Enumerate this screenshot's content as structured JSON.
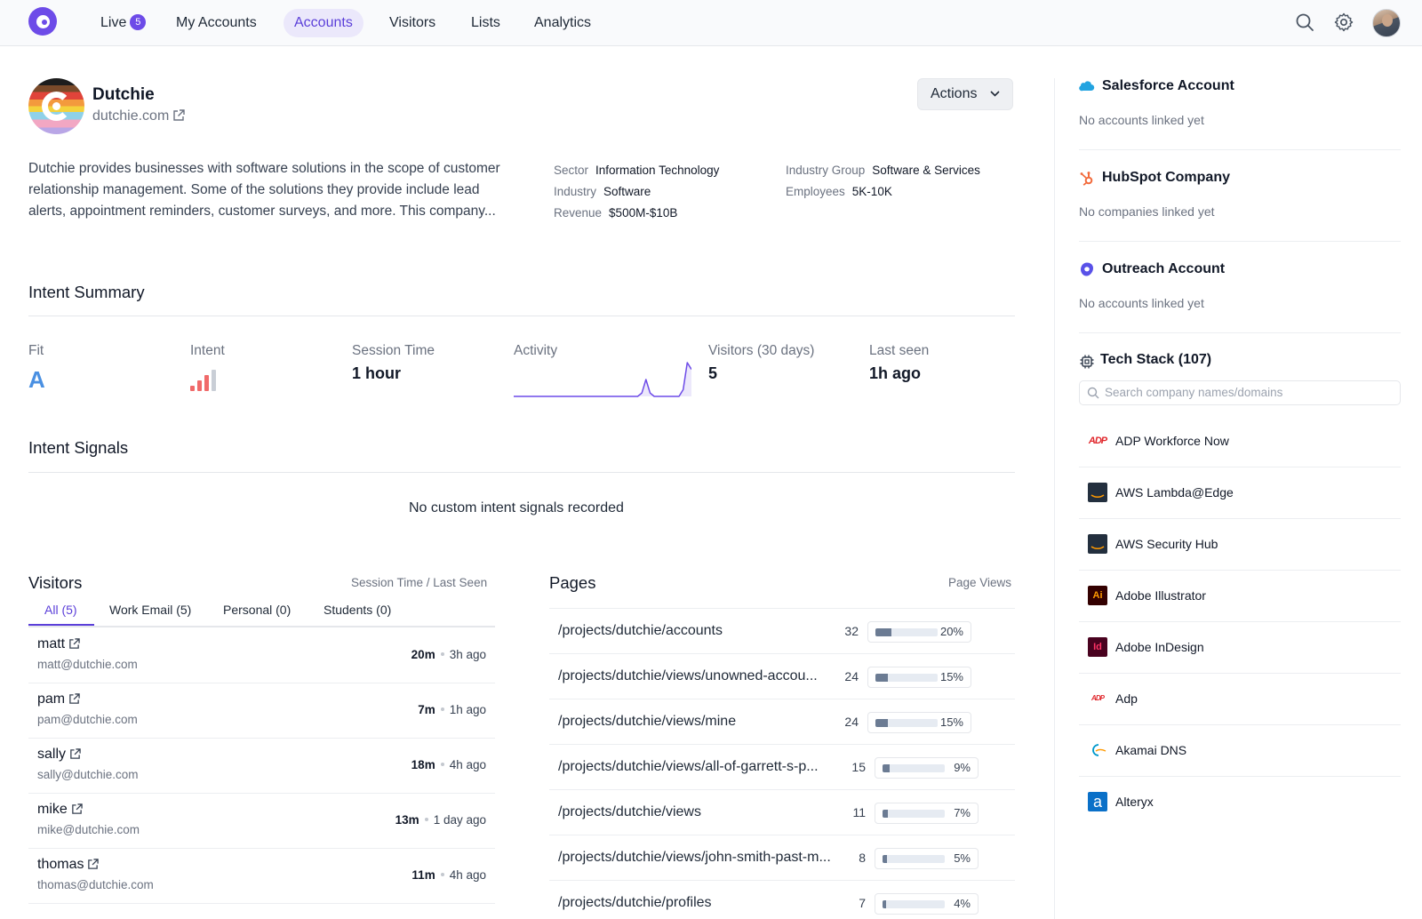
{
  "nav": {
    "live": "Live",
    "live_count": "5",
    "my_accounts": "My Accounts",
    "accounts": "Accounts",
    "visitors": "Visitors",
    "lists": "Lists",
    "analytics": "Analytics"
  },
  "account": {
    "name": "Dutchie",
    "domain": "dutchie.com",
    "description": "Dutchie provides businesses with software solutions in the scope of customer relationship management. Some of the solutions they provide include lead alerts, appointment reminders, customer surveys, and more. This company...",
    "actions_label": "Actions",
    "facts": {
      "sector_label": "Sector",
      "sector": "Information Technology",
      "industry_label": "Industry",
      "industry": "Software",
      "revenue_label": "Revenue",
      "revenue": "$500M-$10B",
      "industry_group_label": "Industry Group",
      "industry_group": "Software & Services",
      "employees_label": "Employees",
      "employees": "5K-10K"
    }
  },
  "intent_summary": {
    "title": "Intent Summary",
    "fit_label": "Fit",
    "fit": "A",
    "intent_label": "Intent",
    "intent_level": 3,
    "intent_max": 4,
    "session_label": "Session Time",
    "session": "1 hour",
    "activity_label": "Activity",
    "activity_series": [
      0,
      0,
      0,
      0,
      0,
      0,
      0,
      0,
      0,
      0,
      0,
      0,
      0,
      0,
      0,
      0,
      0,
      0,
      0,
      0,
      0,
      0,
      0,
      0,
      0,
      0,
      0,
      0,
      0,
      0,
      0,
      2,
      10,
      2,
      0,
      0,
      0,
      0,
      0,
      0,
      0,
      4,
      20,
      16
    ],
    "visitors_label": "Visitors (30 days)",
    "visitors": "5",
    "last_seen_label": "Last seen",
    "last_seen": "1h ago"
  },
  "intent_signals": {
    "title": "Intent Signals",
    "empty": "No custom intent signals recorded"
  },
  "visitors_panel": {
    "title": "Visitors",
    "subtitle": "Session Time / Last Seen",
    "tabs": [
      "All (5)",
      "Work Email (5)",
      "Personal (0)",
      "Students (0)"
    ],
    "rows": [
      {
        "name": "matt",
        "email": "matt@dutchie.com",
        "session": "20m",
        "last_seen": "3h ago"
      },
      {
        "name": "pam",
        "email": "pam@dutchie.com",
        "session": "7m",
        "last_seen": "1h ago"
      },
      {
        "name": "sally",
        "email": "sally@dutchie.com",
        "session": "18m",
        "last_seen": "4h ago"
      },
      {
        "name": "mike",
        "email": "mike@dutchie.com",
        "session": "13m",
        "last_seen": "1 day ago"
      },
      {
        "name": "thomas",
        "email": "thomas@dutchie.com",
        "session": "11m",
        "last_seen": "4h ago"
      }
    ]
  },
  "pages_panel": {
    "title": "Pages",
    "subtitle": "Page Views",
    "rows": [
      {
        "path": "/projects/dutchie/accounts",
        "views": "32",
        "pct": "20%",
        "share": 20
      },
      {
        "path": "/projects/dutchie/views/unowned-accou...",
        "views": "24",
        "pct": "15%",
        "share": 15
      },
      {
        "path": "/projects/dutchie/views/mine",
        "views": "24",
        "pct": "15%",
        "share": 15
      },
      {
        "path": "/projects/dutchie/views/all-of-garrett-s-p...",
        "views": "15",
        "pct": "9%",
        "share": 9
      },
      {
        "path": "/projects/dutchie/views",
        "views": "11",
        "pct": "7%",
        "share": 7
      },
      {
        "path": "/projects/dutchie/views/john-smith-past-m...",
        "views": "8",
        "pct": "5%",
        "share": 5
      },
      {
        "path": "/projects/dutchie/profiles",
        "views": "7",
        "pct": "4%",
        "share": 4
      }
    ]
  },
  "sidebar": {
    "salesforce_title": "Salesforce Account",
    "salesforce_empty": "No accounts linked yet",
    "hubspot_title": "HubSpot Company",
    "hubspot_empty": "No companies linked yet",
    "outreach_title": "Outreach Account",
    "outreach_empty": "No accounts linked yet",
    "tech_title": "Tech Stack (107)",
    "tech_search_placeholder": "Search company names/domains",
    "tech_items": [
      {
        "name": "ADP Workforce Now",
        "icon": "adp-logo-icon",
        "logo_text": "ADP"
      },
      {
        "name": "AWS Lambda@Edge",
        "icon": "aws-logo-icon",
        "logo_text": ""
      },
      {
        "name": "AWS Security Hub",
        "icon": "aws-logo-icon",
        "logo_text": ""
      },
      {
        "name": "Adobe Illustrator",
        "icon": "adobe-illustrator-icon",
        "logo_text": "Ai"
      },
      {
        "name": "Adobe InDesign",
        "icon": "adobe-indesign-icon",
        "logo_text": "Id"
      },
      {
        "name": "Adp",
        "icon": "adp-logo-icon",
        "logo_text": "ADP"
      },
      {
        "name": "Akamai DNS",
        "icon": "akamai-logo-icon",
        "logo_text": ""
      },
      {
        "name": "Alteryx",
        "icon": "alteryx-logo-icon",
        "logo_text": "a"
      }
    ]
  },
  "colors": {
    "brand": "#6d4be8",
    "fit": "#4a90e2",
    "intent_active": "#f06a6a",
    "intent_inactive": "#c9ced6",
    "activity_line": "#6d4be8",
    "bar_fill": "#6b7b93"
  }
}
